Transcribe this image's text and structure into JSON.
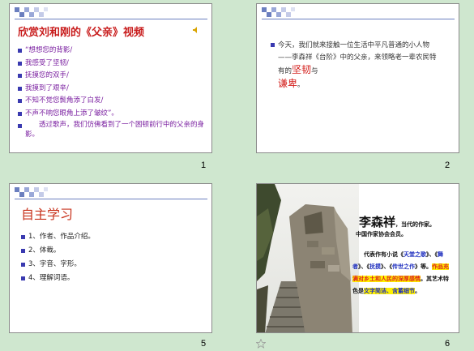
{
  "slides": [
    {
      "number": "1",
      "title": "欣赏刘和刚的《父亲》视频",
      "items": [
        "“想想您的背影/",
        "我感受了坚韧/",
        "抚摸您的双手/",
        "我摸到了艰辛/",
        "不知不觉您鬓角添了白发/",
        "不声不响您眼角上添了皱纹”。"
      ],
      "paragraph": "　　透过歌声，我们仿佛看到了一个困顿前行中的父亲的身影。"
    },
    {
      "number": "2",
      "text_part1": "今天，我们就来接触一位生活中平凡普通的小人物——李森祥《台阶》中的父亲，来领略老一辈农民特有的",
      "highlight1": "坚韧",
      "text_part2": "与",
      "highlight2": "谦卑",
      "text_part3": "。"
    },
    {
      "number": "5",
      "title": "自主学习",
      "items": [
        "1、作者、作品介绍。",
        "2、体裁。",
        "3、字音、字形。",
        "4、理解词语。"
      ]
    },
    {
      "number": "6",
      "author_name": "李森祥",
      "author_desc": "，当代的作家。",
      "author_line2": "中国作家协会会员。",
      "para_intro": "　　代表作有小说《",
      "work1": "天堂之歌",
      "para_mid1": "》、《",
      "work2": "舞者",
      "para_mid2": "》、《",
      "work3": "抚摸",
      "para_mid3": "》、《",
      "work4": "传世之作",
      "para_mid4": "》等。",
      "para_style_red": "作品充满对乡土和人民的深厚感情",
      "para_mid5": "。其艺术特色是",
      "para_style_blue": "文字简洁、含蓄细节",
      "para_end": "。"
    }
  ],
  "colors": {
    "background": "#cfe7cf",
    "title_red": "#c81c1c",
    "bullet_blue": "#3a3ab0",
    "text_purple": "#7a1fa0"
  }
}
